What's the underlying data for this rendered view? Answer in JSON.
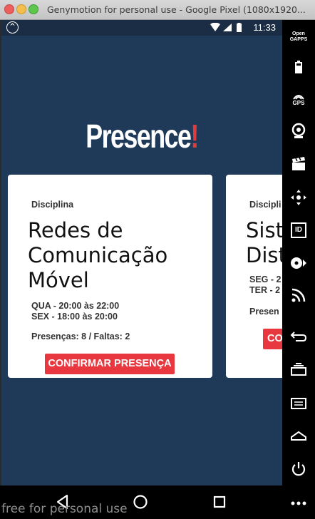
{
  "window": {
    "title": "Genymotion for personal use - Google Pixel (1080x1920..."
  },
  "statusbar": {
    "time": "11:33"
  },
  "app": {
    "brand_name": "Presence",
    "brand_mark": "!",
    "brand_color": "#e03a3e",
    "background_color": "#1f3a58"
  },
  "cards": [
    {
      "label": "Disciplina",
      "title_lines": [
        "Redes de",
        "Comunicação",
        "Móvel"
      ],
      "schedule": [
        "QUA - 20:00 às 22:00",
        "SEX - 18:00 às 20:00"
      ],
      "stats": "Presenças: 8 / Faltas: 2",
      "button_label": "CONFIRMAR PRESENÇA"
    },
    {
      "label": "Discipli",
      "title_lines": [
        "Sist",
        "Dist"
      ],
      "schedule": [
        "SEG - 2",
        "TER - 2"
      ],
      "stats": "Presen",
      "button_label": "CO"
    }
  ],
  "watermark": "free for personal use",
  "toolbar": {
    "items": [
      "opengapps-icon",
      "battery-icon",
      "gps-icon",
      "camera-icon",
      "clapperboard-icon",
      "dpad-icon",
      "id-icon",
      "media-icon",
      "rss-icon",
      "back-icon",
      "recent-apps-icon",
      "menu-icon",
      "home-icon",
      "power-icon",
      "more-icon"
    ],
    "opengapps_label": "Open GAPPS",
    "gps_label": "GPS",
    "id_label": "ID"
  }
}
